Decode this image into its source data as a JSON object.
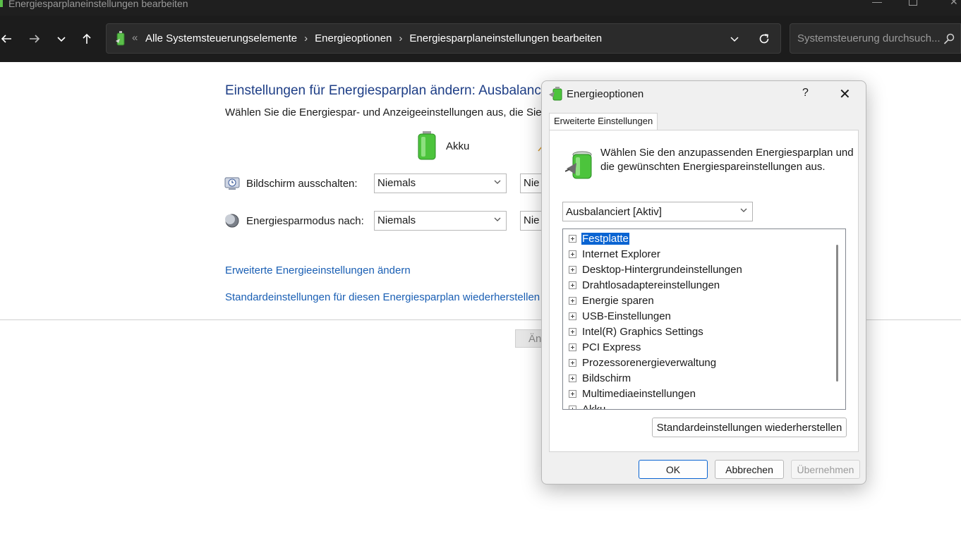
{
  "window": {
    "title": "Energiesparplaneinstellungen bearbeiten"
  },
  "address_bar": {
    "overflow": "«",
    "crumbs": [
      "Alle Systemsteuerungselemente",
      "Energieoptionen",
      "Energiesparplaneinstellungen bearbeiten"
    ],
    "separator": "›"
  },
  "search": {
    "placeholder": "Systemsteuerung durchsuch..."
  },
  "page": {
    "title": "Einstellungen für Energiesparplan ändern: Ausbalanc",
    "description": "Wählen Sie die Energiespar- und Anzeigeeinstellungen aus, die Sie f",
    "column_akku": "Akku",
    "rows": [
      {
        "label": "Bildschirm ausschalten:",
        "akku_value": "Niemals",
        "second_value": "Nie"
      },
      {
        "label": "Energiesparmodus nach:",
        "akku_value": "Niemals",
        "second_value": "Nie"
      }
    ],
    "link_advanced": "Erweiterte Energieeinstellungen ändern",
    "link_restore": "Standardeinstellungen für diesen Energiesparplan wiederherstellen",
    "save_button_partial": "Än"
  },
  "dialog": {
    "title": "Energieoptionen",
    "help": "?",
    "close": "✕",
    "tab": "Erweiterte Einstellungen",
    "intro": "Wählen Sie den anzupassenden Energiesparplan und die gewünschten Energiespareinstellungen aus.",
    "plan_selected": "Ausbalanciert [Aktiv]",
    "tree": [
      "Festplatte",
      "Internet Explorer",
      "Desktop-Hintergrundeinstellungen",
      "Drahtlosadaptereinstellungen",
      "Energie sparen",
      "USB-Einstellungen",
      "Intel(R) Graphics Settings",
      "PCI Express",
      "Prozessorenergieverwaltung",
      "Bildschirm",
      "Multimediaeinstellungen",
      "Akku"
    ],
    "selected_item": "Festplatte",
    "restore_button": "Standardeinstellungen wiederherstellen",
    "ok": "OK",
    "cancel": "Abbrechen",
    "apply": "Übernehmen"
  },
  "colors": {
    "accent": "#0a64d2",
    "title_blue": "#1e3e86",
    "link_blue": "#1a5fb4",
    "chrome_dark": "#1c1c1c"
  }
}
